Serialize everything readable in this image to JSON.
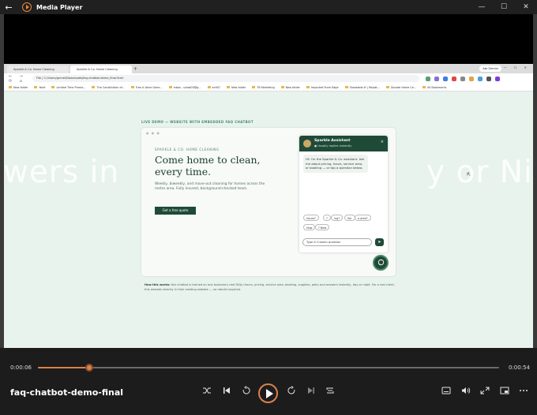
{
  "window": {
    "title": "Media Player",
    "minimize": "—",
    "maximize": "☐",
    "close": "✕",
    "back": "←"
  },
  "browser": {
    "tabs": [
      "Sparkle & Co. Home Cleaning",
      "Sparkle & Co. Home Cleaning"
    ],
    "ask_gemini": "Ask Gemini",
    "url_prefix": "File",
    "url": "C:/Users/gnmel/Downloads/faq-chatbot-demo_final.html",
    "bookmarks": [
      "New folder",
      "Yardi",
      "Limited Time Promo...",
      "The Constitution of...",
      "Tree A Voice Gene...",
      "Inbox - udow00@g...",
      "ecfi47",
      "New folder",
      "TB Marketing",
      "New folder",
      "Imported From Edge",
      "Shareable-Fr | Regist...",
      "Donate Home Ce..."
    ],
    "all_bookmarks": "All Bookmarks"
  },
  "page": {
    "live_demo": "LIVE DEMO — WEBSITE WITH EMBEDDED FAQ CHATBOT",
    "brand": "SPARKLE & CO. HOME CLEANING",
    "headline": "Come home to clean, every time.",
    "description": "Weekly, biweekly, and move-out cleaning for homes across the metro area. Fully insured, background-checked team.",
    "cta": "Get a free quote",
    "howto_label": "How this works:",
    "howto_text": "this chatbot is trained on one business's real FAQs (hours, pricing, service area, booking, supplies, pets) and answers instantly, day or night. For a real client, this embeds directly in their existing website — no rebuild required."
  },
  "chat": {
    "name": "Sparkle Assistant",
    "status": "● Usually replies instantly",
    "close": "×",
    "message": "Hi! I'm the Sparkle & Co. assistant. Ask me about pricing, hours, service area, or booking — or tap a question below.",
    "chips": [
      "Hours?",
      "?",
      "ing?",
      "Ser",
      "a area?",
      "How",
      "? Best"
    ],
    "input_placeholder": "Type A Custom question",
    "send": "➤",
    "fab": "💬"
  },
  "watermark": {
    "left": "wers in",
    "middle": "y or Ni"
  },
  "player": {
    "current_time": "0:00:06",
    "total_time": "0:00:54",
    "progress": 0.111,
    "file_title": "faq-chatbot-demo-final",
    "icons": [
      "shuffle-icon",
      "previous-icon",
      "rewind-10-icon",
      "play-icon",
      "forward-30-icon",
      "next-icon",
      "repeat-icon",
      "subtitles-icon",
      "volume-icon",
      "fullscreen-icon",
      "mini-player-icon",
      "more-icon"
    ]
  },
  "colors": {
    "accent": "#d9824c",
    "brand_green": "#1f4a37",
    "page_bg": "#e9f3ee"
  }
}
